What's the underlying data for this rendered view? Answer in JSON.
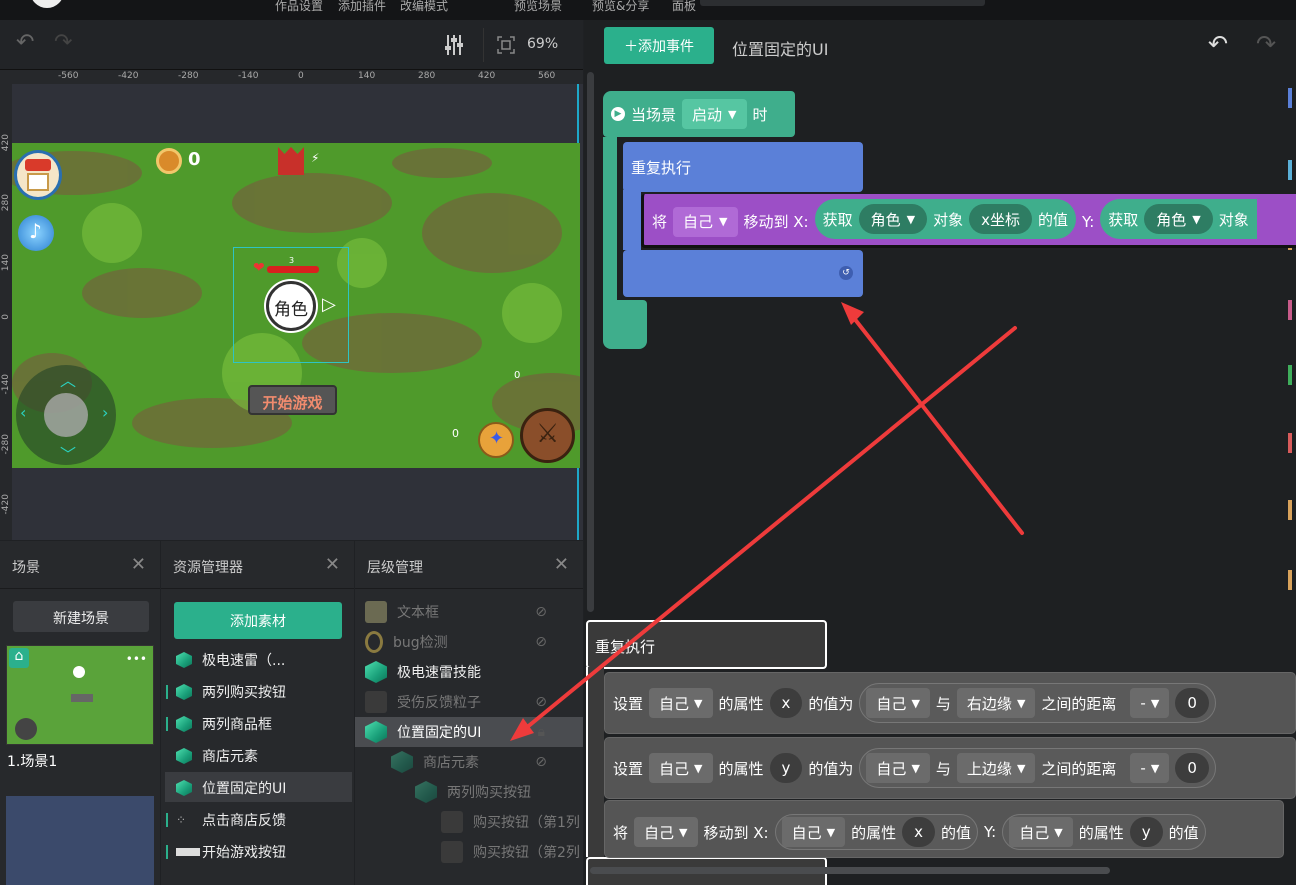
{
  "menu": {
    "items": [
      "作品设置",
      "添加插件",
      "改编模式",
      "预览场景",
      "预览&分享",
      "面板"
    ]
  },
  "stage_toolbar": {
    "zoom": "69%"
  },
  "ruler": {
    "h_ticks": [
      "-560",
      "-420",
      "-280",
      "-140",
      "0",
      "140",
      "280",
      "420",
      "560"
    ],
    "v_ticks": [
      "420",
      "280",
      "140",
      "0",
      "-140",
      "-280",
      "-420"
    ]
  },
  "game": {
    "coin_count": "0",
    "hp_count": "3",
    "character_label": "角色",
    "start_button": "开始游戏",
    "skill_count_a": "0",
    "skill_count_b": "0"
  },
  "scene_panel": {
    "title": "场景",
    "new_button": "新建场景",
    "scene_name": "1.场景1"
  },
  "asset_panel": {
    "title": "资源管理器",
    "add_button": "添加素材",
    "items": [
      "极电速雷（...",
      "两列购买按钮",
      "两列商品框",
      "商店元素",
      "位置固定的UI",
      "点击商店反馈",
      "开始游戏按钮"
    ]
  },
  "layer_panel": {
    "title": "层级管理",
    "items": [
      "文本框",
      "bug检测",
      "极电速雷技能",
      "受伤反馈粒子",
      "位置固定的UI",
      "商店元素",
      "两列购买按钮",
      "购买按钮（第1列",
      "购买按钮（第2列"
    ]
  },
  "workspace": {
    "add_event_button": "添加事件",
    "title": "位置固定的UI",
    "event_block": {
      "prefix": "当场景",
      "event": "启动",
      "suffix": "时"
    },
    "repeat_label": "重复执行",
    "move_block": {
      "t_jiang": "将",
      "self": "自己",
      "move_to_x": "移动到 X:",
      "get": "获取",
      "role": "角色",
      "object": "对象",
      "x_coord": "x坐标",
      "value_of": "的值",
      "y_label": "Y:",
      "get2": "获取",
      "role2": "角色",
      "object2": "对象"
    }
  },
  "popup": {
    "repeat_label": "重复执行",
    "row1": {
      "set": "设置",
      "self": "自己",
      "prop": "的属性",
      "axis": "x",
      "value_is": "的值为",
      "self2": "自己",
      "with": "与",
      "edge": "右边缘",
      "distance": "之间的距离",
      "op": "-",
      "num": "0"
    },
    "row2": {
      "set": "设置",
      "self": "自己",
      "prop": "的属性",
      "axis": "y",
      "value_is": "的值为",
      "self2": "自己",
      "with": "与",
      "edge": "上边缘",
      "distance": "之间的距离",
      "op": "-",
      "num": "0"
    },
    "row3": {
      "jiang": "将",
      "self": "自己",
      "move_to_x": "移动到 X:",
      "self2": "自己",
      "prop": "的属性",
      "axis_x": "x",
      "value_of": "的值",
      "y_label": "Y:",
      "self3": "自己",
      "prop2": "的属性",
      "axis_y": "y",
      "value_of2": "的值"
    }
  },
  "colors": {
    "accent": "#2bb08c",
    "blue_block": "#5b80d8",
    "purple_block": "#9c4fc6",
    "teal_block": "#3fae8c",
    "arrow": "#ee3b3b"
  }
}
